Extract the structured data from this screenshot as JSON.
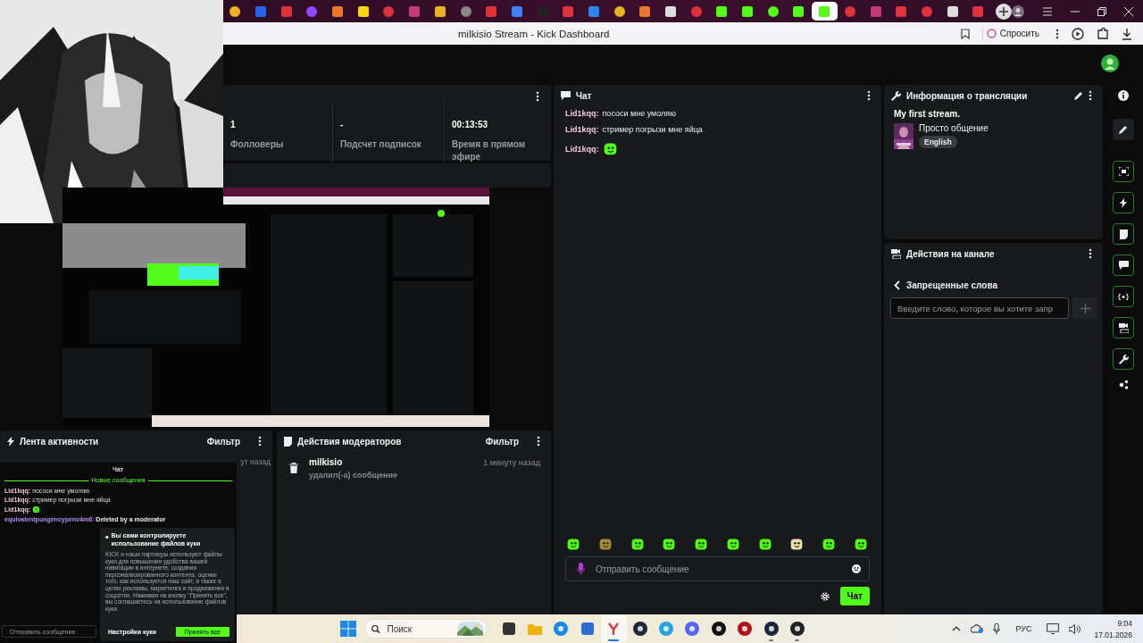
{
  "browser": {
    "tabs": [
      {
        "selected": false
      },
      {
        "selected": false
      },
      {
        "selected": false
      },
      {
        "selected": false
      },
      {
        "selected": false
      },
      {
        "selected": false
      },
      {
        "selected": false
      },
      {
        "selected": false
      },
      {
        "selected": false
      },
      {
        "selected": false
      },
      {
        "selected": false
      },
      {
        "selected": false
      },
      {
        "selected": false
      },
      {
        "selected": false
      },
      {
        "selected": false
      },
      {
        "selected": false
      },
      {
        "selected": false
      },
      {
        "selected": false
      },
      {
        "selected": false
      },
      {
        "selected": false
      },
      {
        "selected": false
      },
      {
        "selected": false
      },
      {
        "selected": false
      },
      {
        "selected": true
      },
      {
        "selected": false
      },
      {
        "selected": false
      },
      {
        "selected": false
      },
      {
        "selected": false
      },
      {
        "selected": false
      },
      {
        "selected": false
      }
    ],
    "title": "milkisio Stream - Kick Dashboard",
    "ask_button": "Спросить"
  },
  "stats": {
    "items": [
      {
        "value": "1",
        "label": "Фолловеры"
      },
      {
        "value": "-",
        "label": "Подсчет подписок"
      },
      {
        "value": "00:13:53",
        "label": "Время в прямом эфире"
      }
    ]
  },
  "activity_feed": {
    "title": "Лента активности",
    "filter": "Фильтр",
    "items": [
      {
        "time": "ут назад"
      }
    ]
  },
  "mod_actions": {
    "title": "Действия модераторов",
    "filter": "Фильтр",
    "items": [
      {
        "user": "milkisio",
        "action": "удалил(-а) сообщение",
        "time": "1 минуту назад"
      }
    ]
  },
  "chat": {
    "title": "Чат",
    "messages": [
      {
        "kind": "text",
        "user": "Lid1kqq:",
        "text": "пососи мне умоляю"
      },
      {
        "kind": "text",
        "user": "Lid1kqq:",
        "text": "стример погрызи мне яйца"
      },
      {
        "kind": "emote",
        "user": "Lid1kqq:"
      }
    ],
    "input": {
      "placeholder": "Отправить сообщение"
    },
    "send_button": "Чат"
  },
  "stream_info": {
    "title": "Информация о трансляции",
    "stream_title": "My first stream.",
    "category": "Просто общение",
    "language": "English"
  },
  "channel_actions": {
    "title": "Действия на канале",
    "section": "Запрещенные слова",
    "input": {
      "placeholder": "Введите слово, которое вы хотите запр"
    }
  },
  "overlay_chat": {
    "title": "Чат",
    "divider": "Новые сообщения",
    "messages": [
      {
        "kind": "text",
        "user": "Lid1kqq:",
        "text": "пососи мне умоляю"
      },
      {
        "kind": "text",
        "user": "Lid1kqq:",
        "text": "стример погрызи мне яйца"
      },
      {
        "kind": "emote",
        "user": "Lid1kqq:"
      },
      {
        "kind": "deleted",
        "user": "equivalentpungencypenv4m6:",
        "text": "Deleted by a moderator"
      }
    ],
    "cookie": {
      "title": "Вы сами контролируете использование файлов куки",
      "text": "KICK и наши партнеры используют файлы куки для повышения удобства вашей навигации в интернете, создания персонализированного контента, оценки того, как используется наш сайт, а также в целях рекламы, маркетинга и продвижения в соцсетях. Нажимая на кнопку \"Принять все\", вы соглашаетесь на использование файлов куки.",
      "settings_button": "Настройки куки",
      "accept_button": "Принять все"
    },
    "input": {
      "placeholder": "Отправить сообщение"
    }
  },
  "taskbar": {
    "search": {
      "placeholder": "Поиск"
    },
    "apps": [
      {
        "selected": false,
        "running": false
      },
      {
        "selected": false,
        "running": false
      },
      {
        "selected": false,
        "running": false
      },
      {
        "selected": false,
        "running": false
      },
      {
        "selected": true,
        "running": true
      },
      {
        "selected": false,
        "running": false
      },
      {
        "selected": false,
        "running": false
      },
      {
        "selected": false,
        "running": false
      },
      {
        "selected": false,
        "running": false
      },
      {
        "selected": false,
        "running": false
      },
      {
        "selected": false,
        "running": true
      },
      {
        "selected": false,
        "running": true
      }
    ],
    "language": "РУС",
    "time": "9:04",
    "date": "17.01.2026"
  }
}
